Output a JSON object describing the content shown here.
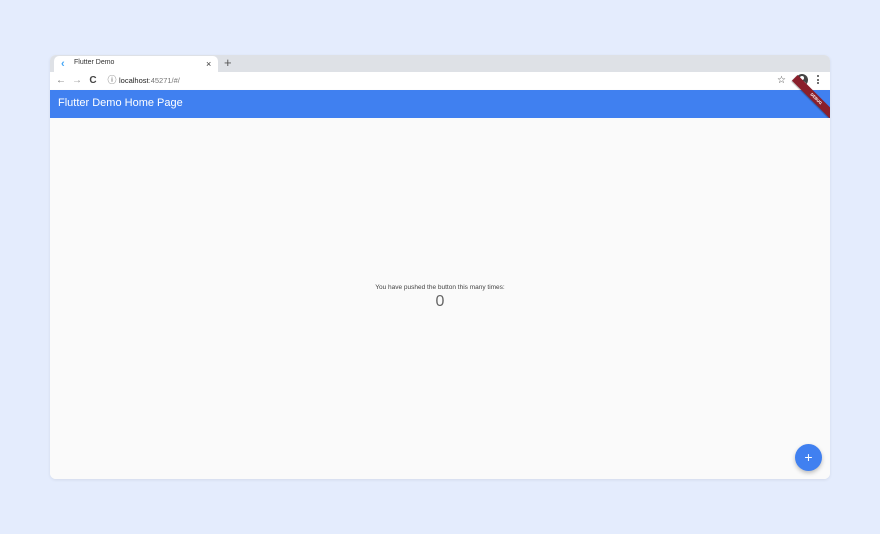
{
  "browser": {
    "tab": {
      "favicon_icon": "flutter-icon",
      "title": "Flutter Demo",
      "close_label": "×"
    },
    "new_tab_label": "+",
    "toolbar": {
      "back_label": "←",
      "forward_label": "→",
      "reload_label": "C",
      "info_label": "ⓘ",
      "address_host": "localhost",
      "address_path": ":45271/#/",
      "star_label": "☆"
    }
  },
  "app": {
    "appbar_title": "Flutter Demo Home Page",
    "appbar_color": "#4080f0",
    "debug_banner": "DEBUG",
    "counter_label": "You have pushed the button this many times:",
    "counter_value": "0",
    "fab_label": "+"
  }
}
